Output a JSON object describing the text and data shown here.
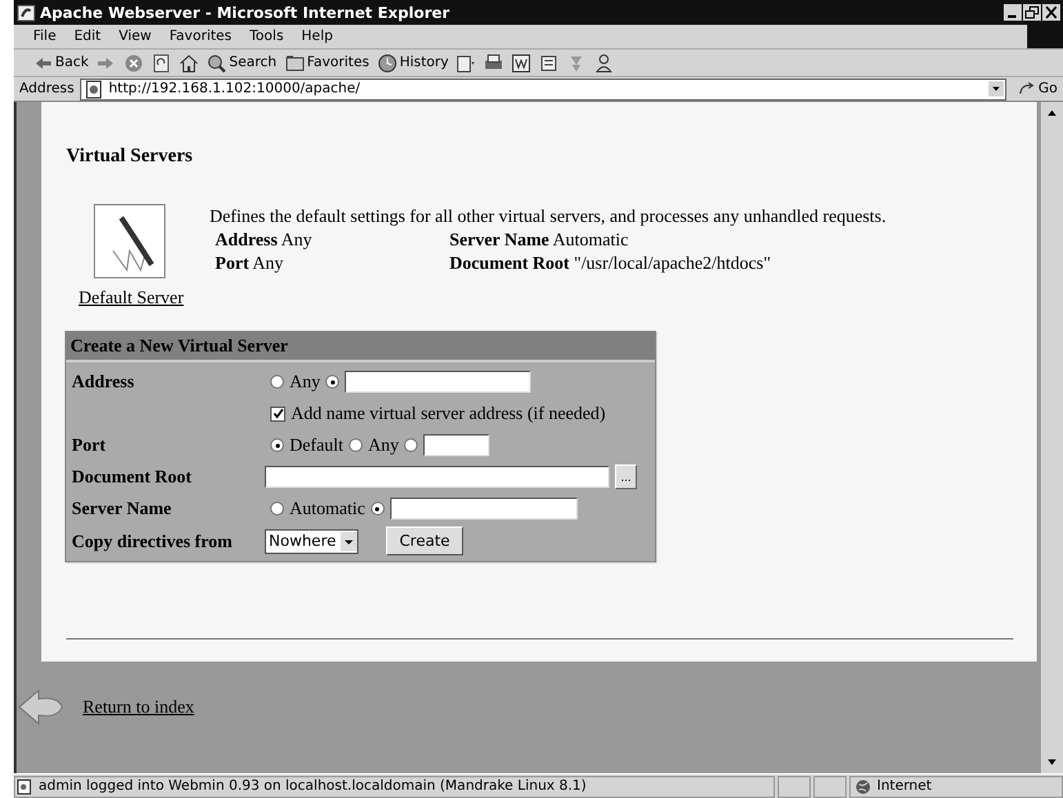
{
  "window": {
    "title": "Apache Webserver - Microsoft Internet Explorer"
  },
  "menu": [
    "File",
    "Edit",
    "View",
    "Favorites",
    "Tools",
    "Help"
  ],
  "toolbar": [
    {
      "kind": "back",
      "label": "Back"
    },
    {
      "kind": "forward"
    },
    {
      "kind": "stop"
    },
    {
      "kind": "refresh"
    },
    {
      "kind": "home"
    },
    {
      "kind": "search",
      "label": "Search"
    },
    {
      "kind": "favorites",
      "label": "Favorites"
    },
    {
      "kind": "history",
      "label": "History"
    },
    {
      "kind": "mail"
    },
    {
      "kind": "print"
    },
    {
      "kind": "edit"
    },
    {
      "kind": "discuss"
    },
    {
      "kind": "messenger"
    },
    {
      "kind": "person"
    }
  ],
  "address": {
    "label": "Address",
    "url": "http://192.168.1.102:10000/apache/",
    "go": "Go"
  },
  "page": {
    "heading": "Virtual Servers",
    "default_server": {
      "link": "Default Server",
      "description": "Defines the default settings for all other virtual servers, and processes any unhandled requests.",
      "fields": [
        {
          "label": "Address",
          "value": "Any"
        },
        {
          "label": "Server Name",
          "value": "Automatic"
        },
        {
          "label": "Port",
          "value": "Any"
        },
        {
          "label": "Document Root",
          "value": "\"/usr/local/apache2/htdocs\""
        }
      ]
    },
    "form": {
      "title": "Create a New Virtual Server",
      "rows": [
        {
          "kind": "radios",
          "label": "Address",
          "options": [
            {
              "kind": "choice",
              "label": "Any",
              "selected": false
            },
            {
              "kind": "text",
              "selected": true
            }
          ]
        },
        {
          "kind": "checkbox",
          "label": "Add name virtual server address (if needed)",
          "checked": true
        },
        {
          "kind": "radios",
          "label": "Port",
          "options": [
            {
              "kind": "choice",
              "label": "Default",
              "selected": true
            },
            {
              "kind": "choice",
              "label": "Any",
              "selected": false
            },
            {
              "kind": "text",
              "selected": false
            }
          ]
        },
        {
          "kind": "file",
          "label": "Document Root",
          "browse": "..."
        },
        {
          "kind": "radios",
          "label": "Server Name",
          "options": [
            {
              "kind": "choice",
              "label": "Automatic",
              "selected": false
            },
            {
              "kind": "text",
              "selected": true
            }
          ]
        },
        {
          "kind": "select",
          "label": "Copy directives from",
          "value": "Nowhere",
          "button": "Create"
        }
      ]
    },
    "return_link": "Return to index"
  },
  "status_bar": {
    "text": "admin logged into Webmin 0.93 on localhost.localdomain (Mandrake Linux 8.1)",
    "zone": "Internet"
  }
}
